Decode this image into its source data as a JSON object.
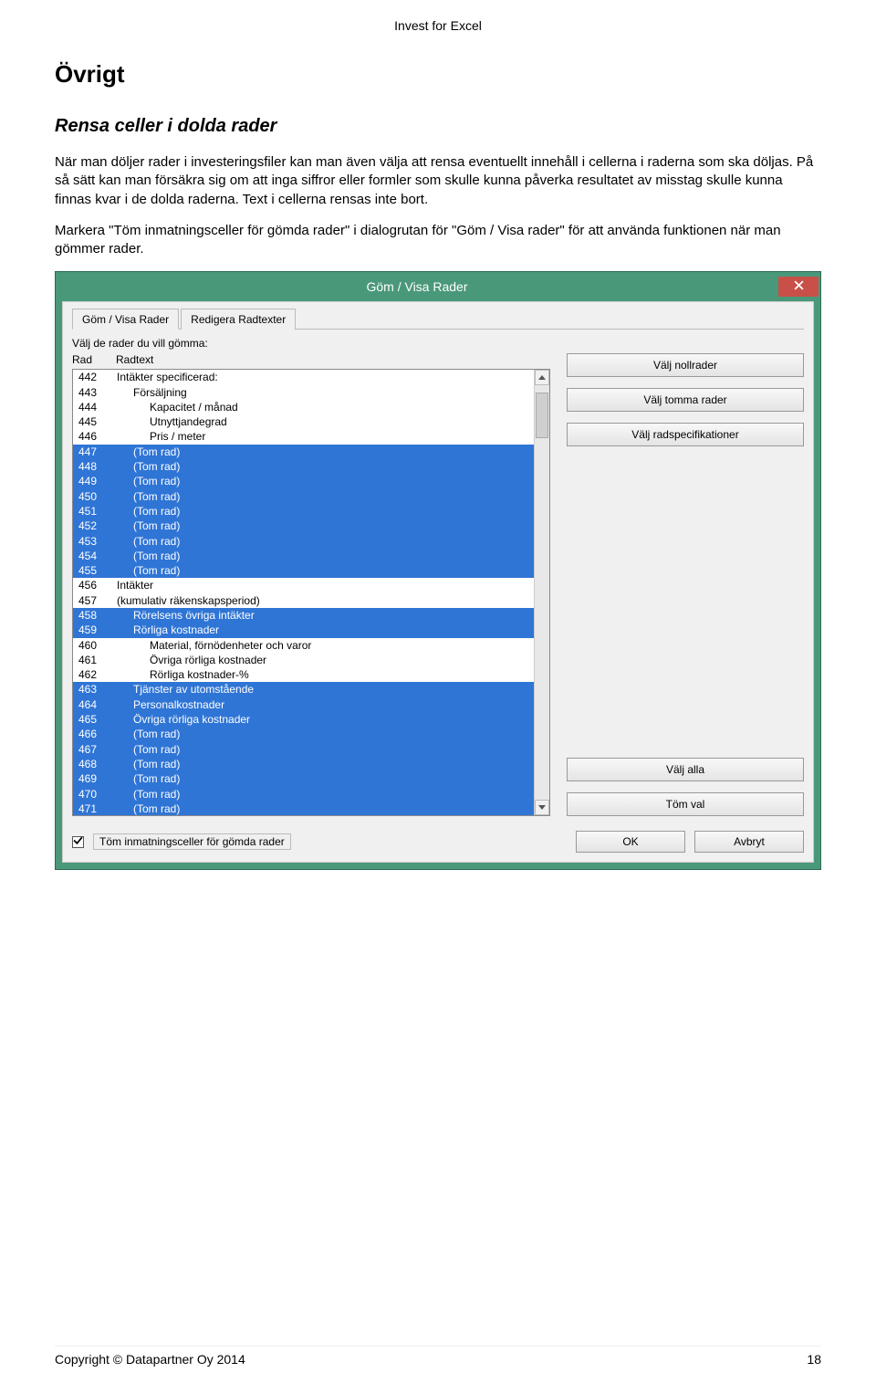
{
  "doc": {
    "header": "Invest for Excel",
    "h1": "Övrigt",
    "h2": "Rensa celler i dolda rader",
    "p1": "När man döljer rader i investeringsfiler kan man även välja att rensa eventuellt innehåll i cellerna i raderna som ska döljas. På så sätt kan man försäkra sig om att inga siffror eller formler som skulle kunna påverka resultatet av misstag skulle kunna finnas kvar i de dolda raderna. Text i cellerna rensas inte bort.",
    "p2": "Markera \"Töm inmatningsceller för gömda rader\" i dialogrutan för \"Göm / Visa rader\" för att använda funktionen när man gömmer rader.",
    "footer_left": "Copyright © Datapartner Oy 2014",
    "footer_right": "18"
  },
  "dialog": {
    "title": "Göm / Visa Rader",
    "tabs": [
      "Göm / Visa Rader",
      "Redigera Radtexter"
    ],
    "instruction": "Välj de rader du vill gömma:",
    "headers": {
      "row": "Rad",
      "text": "Radtext"
    },
    "rows": [
      {
        "num": "442",
        "text": "Intäkter specificerad:",
        "indent": 0,
        "sel": false
      },
      {
        "num": "443",
        "text": "Försäljning",
        "indent": 1,
        "sel": false
      },
      {
        "num": "444",
        "text": "Kapacitet / månad",
        "indent": 2,
        "sel": false
      },
      {
        "num": "445",
        "text": "Utnyttjandegrad",
        "indent": 2,
        "sel": false
      },
      {
        "num": "446",
        "text": "Pris / meter",
        "indent": 2,
        "sel": false
      },
      {
        "num": "447",
        "text": "(Tom rad)",
        "indent": 1,
        "sel": true
      },
      {
        "num": "448",
        "text": "(Tom rad)",
        "indent": 1,
        "sel": true
      },
      {
        "num": "449",
        "text": "(Tom rad)",
        "indent": 1,
        "sel": true
      },
      {
        "num": "450",
        "text": "(Tom rad)",
        "indent": 1,
        "sel": true
      },
      {
        "num": "451",
        "text": "(Tom rad)",
        "indent": 1,
        "sel": true
      },
      {
        "num": "452",
        "text": "(Tom rad)",
        "indent": 1,
        "sel": true
      },
      {
        "num": "453",
        "text": "(Tom rad)",
        "indent": 1,
        "sel": true
      },
      {
        "num": "454",
        "text": "(Tom rad)",
        "indent": 1,
        "sel": true
      },
      {
        "num": "455",
        "text": "(Tom rad)",
        "indent": 1,
        "sel": true
      },
      {
        "num": "456",
        "text": "Intäkter",
        "indent": 0,
        "sel": false
      },
      {
        "num": "457",
        "text": "(kumulativ räkenskapsperiod)",
        "indent": 0,
        "sel": false
      },
      {
        "num": "458",
        "text": "Rörelsens övriga intäkter",
        "indent": 1,
        "sel": true
      },
      {
        "num": "459",
        "text": "Rörliga kostnader",
        "indent": 1,
        "sel": true
      },
      {
        "num": "460",
        "text": "Material, förnödenheter och varor",
        "indent": 2,
        "sel": false
      },
      {
        "num": "461",
        "text": "Övriga rörliga kostnader",
        "indent": 2,
        "sel": false
      },
      {
        "num": "462",
        "text": "Rörliga kostnader-%",
        "indent": 2,
        "sel": false
      },
      {
        "num": "463",
        "text": "Tjänster av utomstående",
        "indent": 1,
        "sel": true
      },
      {
        "num": "464",
        "text": "Personalkostnader",
        "indent": 1,
        "sel": true
      },
      {
        "num": "465",
        "text": "Övriga rörliga kostnader",
        "indent": 1,
        "sel": true
      },
      {
        "num": "466",
        "text": "(Tom rad)",
        "indent": 1,
        "sel": true
      },
      {
        "num": "467",
        "text": "(Tom rad)",
        "indent": 1,
        "sel": true
      },
      {
        "num": "468",
        "text": "(Tom rad)",
        "indent": 1,
        "sel": true
      },
      {
        "num": "469",
        "text": "(Tom rad)",
        "indent": 1,
        "sel": true
      },
      {
        "num": "470",
        "text": "(Tom rad)",
        "indent": 1,
        "sel": true
      },
      {
        "num": "471",
        "text": "(Tom rad)",
        "indent": 1,
        "sel": true
      }
    ],
    "side_buttons": {
      "zero": "Välj nollrader",
      "empty": "Välj tomma rader",
      "spec": "Välj radspecifikationer",
      "all": "Välj alla",
      "clear": "Töm val"
    },
    "checkbox_label": "Töm inmatningsceller för gömda rader",
    "ok": "OK",
    "cancel": "Avbryt"
  }
}
